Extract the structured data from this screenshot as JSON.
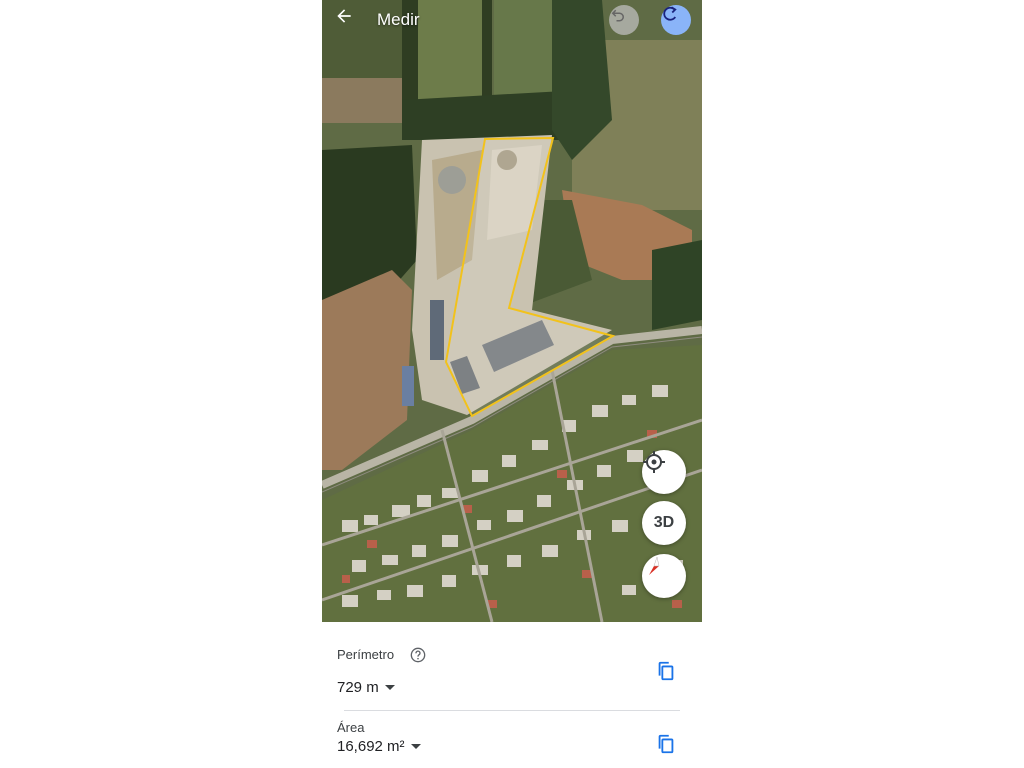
{
  "header": {
    "title": "Medir"
  },
  "icons": {
    "back": "arrow-back-icon",
    "undo": "undo-icon",
    "redo": "redo-icon",
    "locate": "my-location-icon",
    "compass": "compass-icon",
    "help": "help-circle-icon",
    "copy": "copy-icon"
  },
  "fab": {
    "three_d_label": "3D"
  },
  "measure": {
    "perimeter_label": "Perímetro",
    "perimeter_value": "729 m",
    "area_label": "Área",
    "area_value": "16,692 m²"
  },
  "colors": {
    "outline": "#f2c21b",
    "accent": "#1a73e8",
    "redo_bg": "#8ab4f8"
  }
}
